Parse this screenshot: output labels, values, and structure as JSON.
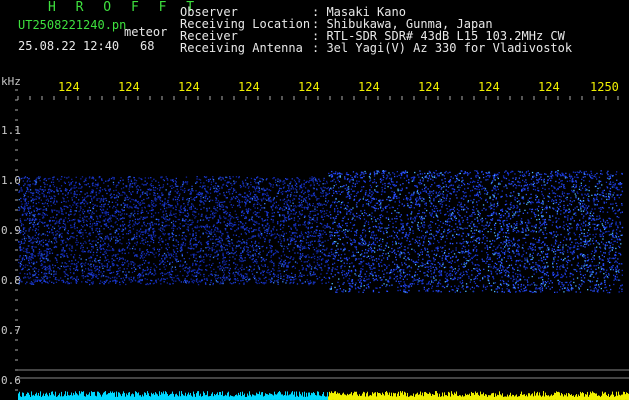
{
  "header": {
    "title": "H R O F F T",
    "filename": "UT2508221240.pn",
    "meteor_label": "meteor",
    "datetime": "25.08.22 12:40",
    "count": "68",
    "observer_label": "Observer",
    "observer_value": ": Masaki Kano",
    "location_label": "Receiving Location",
    "location_value": ": Shibukawa, Gunma, Japan",
    "receiver_label": "Receiver",
    "receiver_value": ": RTL-SDR SDR# 43dB L15 103.2MHz CW",
    "antenna_label": "Receiving Antenna",
    "antenna_value": ": 3el Yagi(V) Az 330 for Vladivostok"
  },
  "axes": {
    "unit": "kHz",
    "y_ticks": [
      "1.1",
      "1.0",
      "0.9",
      "0.8",
      "0.7",
      "0.6"
    ],
    "x_ticks": [
      "124",
      "124",
      "124",
      "124",
      "124",
      "124",
      "124",
      "124",
      "124",
      "1250"
    ]
  },
  "colors": {
    "background": "#000000",
    "signal": "#1a3cff",
    "text_yellow": "#f0f000",
    "text_green": "#3ee03e"
  }
}
